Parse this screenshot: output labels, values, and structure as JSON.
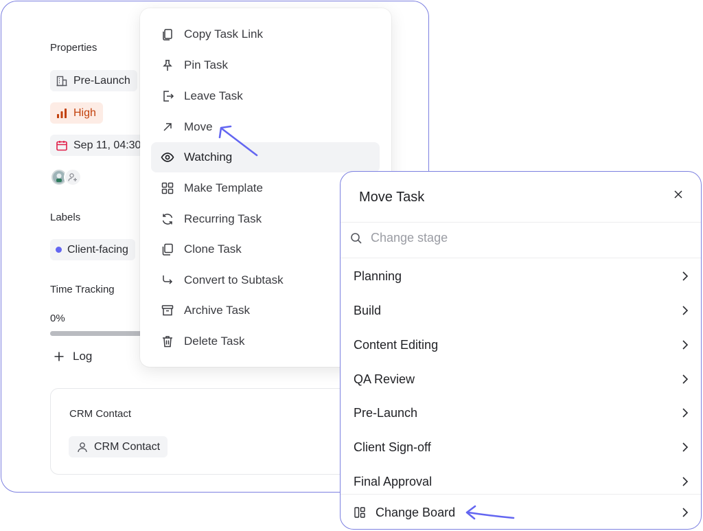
{
  "properties": {
    "heading": "Properties",
    "stage": "Pre-Launch",
    "priority": "High",
    "due_date": "Sep 11, 04:30",
    "colors": {
      "priority_text": "#c2410c",
      "priority_bg": "#fdece5",
      "date_icon": "#e11d48"
    }
  },
  "labels": {
    "heading": "Labels",
    "items": [
      "Client-facing"
    ],
    "dot_color": "#6366f1"
  },
  "time_tracking": {
    "heading": "Time Tracking",
    "percent_label": "0%",
    "progress": 0,
    "log_label": "Log"
  },
  "crm": {
    "heading": "CRM Contact",
    "chip_label": "CRM Contact"
  },
  "context_menu": {
    "items": [
      {
        "label": "Copy Task Link",
        "icon": "copy-link-icon"
      },
      {
        "label": "Pin Task",
        "icon": "pin-icon"
      },
      {
        "label": "Leave Task",
        "icon": "leave-icon"
      },
      {
        "label": "Move",
        "icon": "arrow-up-right-icon"
      },
      {
        "label": "Watching",
        "icon": "eye-icon",
        "active": true
      },
      {
        "label": "Make Template",
        "icon": "template-icon"
      },
      {
        "label": "Recurring Task",
        "icon": "recurring-icon"
      },
      {
        "label": "Clone Task",
        "icon": "clone-icon"
      },
      {
        "label": "Convert to Subtask",
        "icon": "subtask-arrow-icon"
      },
      {
        "label": "Archive Task",
        "icon": "archive-icon"
      },
      {
        "label": "Delete Task",
        "icon": "trash-icon"
      }
    ]
  },
  "move_dialog": {
    "title": "Move Task",
    "search_placeholder": "Change stage",
    "stages": [
      "Planning",
      "Build",
      "Content Editing",
      "QA Review",
      "Pre-Launch",
      "Client Sign-off",
      "Final Approval"
    ],
    "change_board_label": "Change Board"
  },
  "accent_color": "#6366f1"
}
